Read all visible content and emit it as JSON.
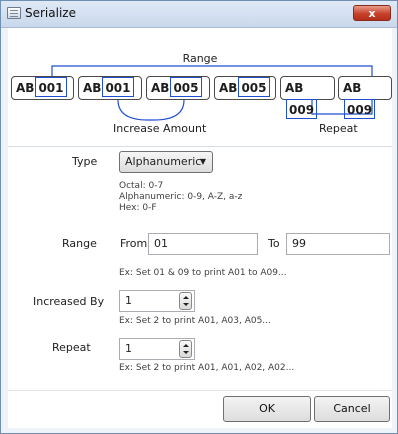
{
  "window": {
    "title": "Serialize",
    "close_label": "x"
  },
  "illustration": {
    "range_label": "Range",
    "badges": [
      {
        "prefix": "AB",
        "number": "001"
      },
      {
        "prefix": "AB",
        "number": "001"
      },
      {
        "prefix": "AB",
        "number": "005"
      },
      {
        "prefix": "AB",
        "number": "005"
      },
      {
        "prefix": "AB",
        "number": "009"
      },
      {
        "prefix": "AB",
        "number": "009"
      }
    ],
    "increase_label": "Increase Amount",
    "repeat_label": "Repeat",
    "accent_color": "#1f4fd1"
  },
  "form": {
    "type": {
      "label": "Type",
      "value": "Alphanumeric",
      "hint_lines": [
        "Octal: 0-7",
        "Alphanumeric: 0-9, A-Z, a-z",
        "Hex: 0-F"
      ]
    },
    "range": {
      "label": "Range",
      "from_label": "From",
      "from_value": "01",
      "to_label": "To",
      "to_value": "99",
      "hint": "Ex: Set 01 & 09 to print A01 to A09..."
    },
    "increased_by": {
      "label": "Increased By",
      "value": "1",
      "hint": "Ex: Set 2 to print A01, A03, A05..."
    },
    "repeat": {
      "label": "Repeat",
      "value": "1",
      "hint": "Ex: Set 2 to print A01, A01, A02, A02..."
    }
  },
  "buttons": {
    "ok": "OK",
    "cancel": "Cancel"
  }
}
